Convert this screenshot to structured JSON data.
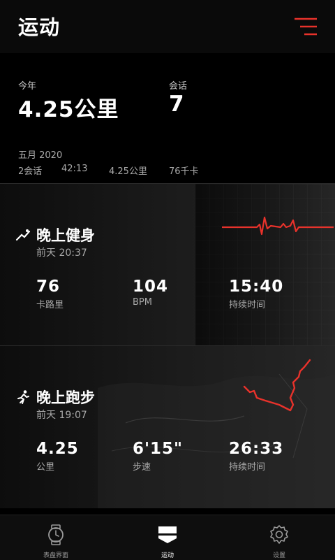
{
  "header": {
    "title": "运动",
    "menu_icon": "menu-icon"
  },
  "summary": {
    "year_label": "今年",
    "year_value": "4.25公里",
    "sessions_label": "会话",
    "sessions_value": "7",
    "month": {
      "label": "五月 2020",
      "sessions": "2会话",
      "duration": "42:13",
      "distance": "4.25公里",
      "calories": "76千卡"
    }
  },
  "workouts": [
    {
      "name": "晚上健身",
      "time": "前天 20:37",
      "icon": "fitness-icon",
      "stats": [
        {
          "value": "76",
          "label": "卡路里"
        },
        {
          "value": "104",
          "label": "BPM"
        },
        {
          "value": "15:40",
          "label": "持续时间"
        }
      ]
    },
    {
      "name": "晚上跑步",
      "time": "前天 19:07",
      "icon": "running-icon",
      "stats": [
        {
          "value": "4.25",
          "label": "公里"
        },
        {
          "value": "6'15\"",
          "label": "步速"
        },
        {
          "value": "26:33",
          "label": "持续时间"
        }
      ]
    }
  ],
  "bottom_nav": [
    {
      "label": "表盘界面",
      "icon": "watch-icon",
      "active": false
    },
    {
      "label": "运动",
      "icon": "workout-icon",
      "active": true
    },
    {
      "label": "设置",
      "icon": "gear-icon",
      "active": false
    }
  ],
  "colors": {
    "accent": "#e8322b",
    "background": "#000000"
  }
}
